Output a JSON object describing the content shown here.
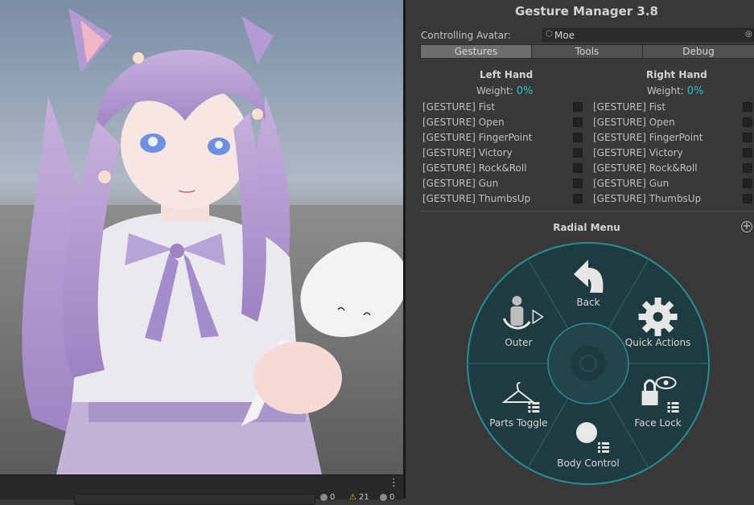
{
  "inspector": {
    "title": "Gesture Manager 3.8",
    "controlling_label": "Controlling Avatar:",
    "avatar_name": "Moe",
    "tabs": [
      {
        "label": "Gestures",
        "active": true
      },
      {
        "label": "Tools",
        "active": false
      },
      {
        "label": "Debug",
        "active": false
      }
    ],
    "left_hand": {
      "heading": "Left Hand",
      "weight_label": "Weight:",
      "weight_value": "0%",
      "gestures": [
        "[GESTURE] Fist",
        "[GESTURE] Open",
        "[GESTURE] FingerPoint",
        "[GESTURE] Victory",
        "[GESTURE] Rock&Roll",
        "[GESTURE] Gun",
        "[GESTURE] ThumbsUp"
      ]
    },
    "right_hand": {
      "heading": "Right Hand",
      "weight_label": "Weight:",
      "weight_value": "0%",
      "gestures": [
        "[GESTURE] Fist",
        "[GESTURE] Open",
        "[GESTURE] FingerPoint",
        "[GESTURE] Victory",
        "[GESTURE] Rock&Roll",
        "[GESTURE] Gun",
        "[GESTURE] ThumbsUp"
      ]
    },
    "radial_menu": {
      "title": "Radial Menu",
      "items": [
        {
          "label": "Back",
          "icon": "back-arrow-icon"
        },
        {
          "label": "Quick Actions",
          "icon": "gear-icon"
        },
        {
          "label": "Face Lock",
          "icon": "lock-eye-icon"
        },
        {
          "label": "Body Control",
          "icon": "sphere-list-icon"
        },
        {
          "label": "Parts Toggle",
          "icon": "hanger-list-icon"
        },
        {
          "label": "Outer",
          "icon": "figure-play-icon"
        }
      ]
    }
  },
  "bottombar": {
    "more_icon": "⋮",
    "counts": [
      "0",
      "21",
      "0"
    ]
  },
  "colors": {
    "accent": "#2fbfcc",
    "radial_fill": "#1e3b41",
    "radial_ring": "#2a8c97"
  }
}
